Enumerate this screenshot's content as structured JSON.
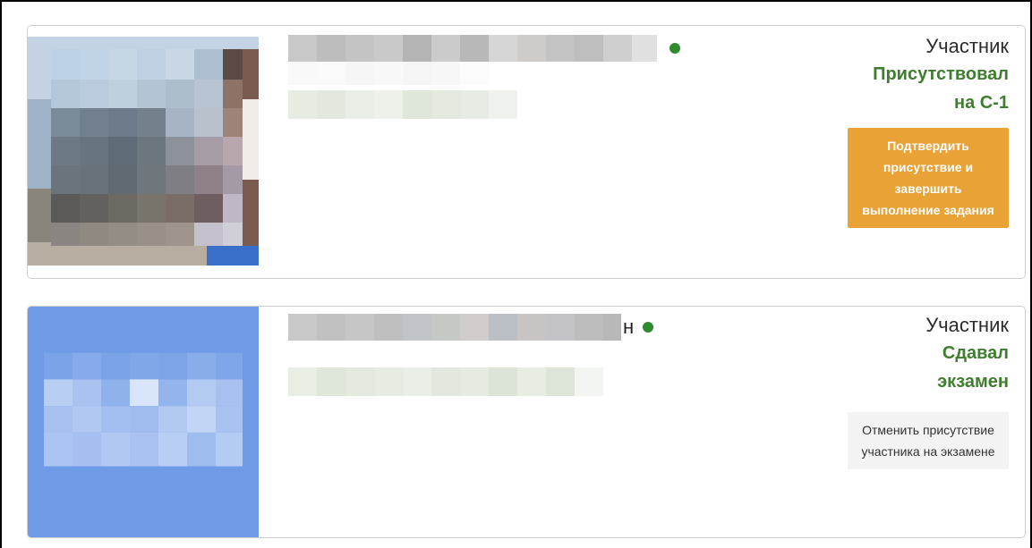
{
  "participants": [
    {
      "role": "Участник",
      "status": "Присутствовал на С-1",
      "online": true,
      "action": "Подтвердить присутствие и завершить выполнение задания",
      "action_color": "#e9a235"
    },
    {
      "name_visible_fragment": "н",
      "role": "Участник",
      "status": "Сдавал экзамен",
      "online": true,
      "action": "Отменить присутствие участника на экзамене",
      "action_color": "#f3f3f3"
    }
  ],
  "colors": {
    "online_dot": "#2e8b2e",
    "status_text": "#3f7d2f",
    "avatar2_bg": "#6f9be6"
  }
}
